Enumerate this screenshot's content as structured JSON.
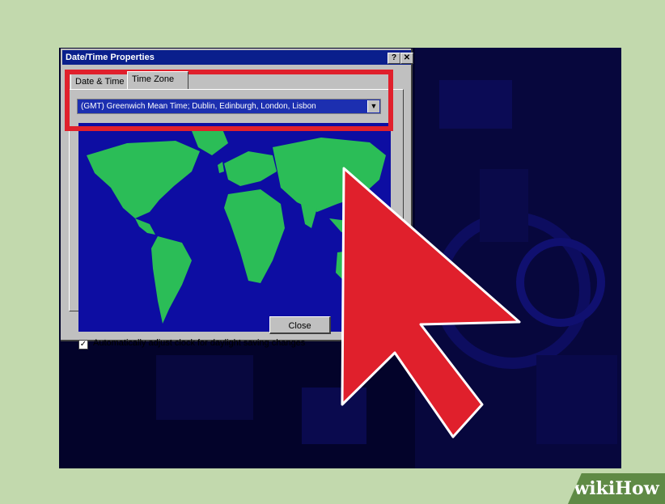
{
  "dialog": {
    "title": "Date/Time Properties",
    "help_glyph": "?",
    "close_glyph": "✕"
  },
  "tabs": [
    {
      "label": "Date & Time",
      "selected": false
    },
    {
      "label": "Time Zone",
      "selected": true
    }
  ],
  "timezone": {
    "value": "(GMT) Greenwich Mean Time; Dublin, Edinburgh, London, Lisbon",
    "dropdown_glyph": "▼"
  },
  "dst": {
    "checked": true,
    "check_glyph": "✓",
    "label": "Automatically adjust clock for daylight saving changes"
  },
  "buttons": {
    "close_label": "Close"
  },
  "annotations": {
    "highlight_color": "#e0202c",
    "cursor_color": "#e0202c"
  },
  "watermark": {
    "text": "wikiHow"
  },
  "colors": {
    "title_bar": "#0a1f8c",
    "map_ocean": "#0d0da2",
    "map_land": "#2bbd57",
    "background": "#c2d9ad"
  }
}
